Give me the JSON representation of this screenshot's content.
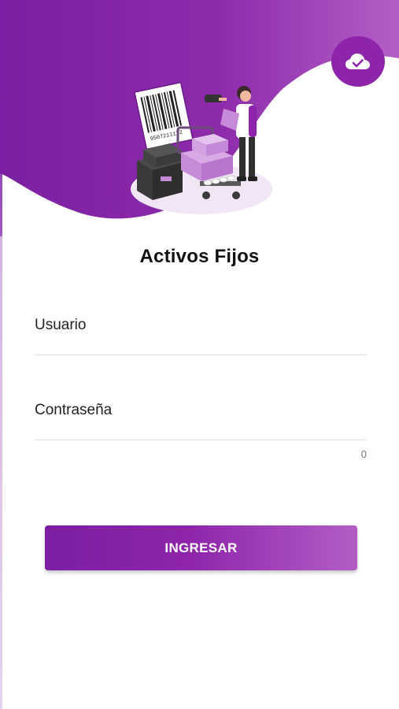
{
  "header": {
    "cloud_icon": "cloud-check-icon",
    "illustration_icon": "warehouse-barcode-scanner-illustration",
    "illustration_barcode_text": "9507211172"
  },
  "login": {
    "title": "Activos Fijos",
    "username_placeholder": "Usuario",
    "password_placeholder": "Contraseña",
    "password_counter": "0",
    "submit_label": "INGRESAR"
  },
  "colors": {
    "primary": "#8e24aa",
    "primary_dark": "#7b1fa2",
    "primary_light": "#b25dc6",
    "title_text": "#111111",
    "field_underline": "#e0e0e0"
  }
}
